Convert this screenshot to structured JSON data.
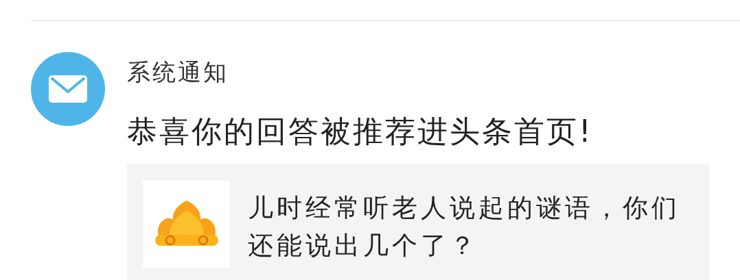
{
  "notification": {
    "sender": "系统通知",
    "message": "恭喜你的回答被推荐进头条首页!",
    "card": {
      "question": "儿时经常听老人说起的谜语，你们还能说出几个了？"
    }
  }
}
